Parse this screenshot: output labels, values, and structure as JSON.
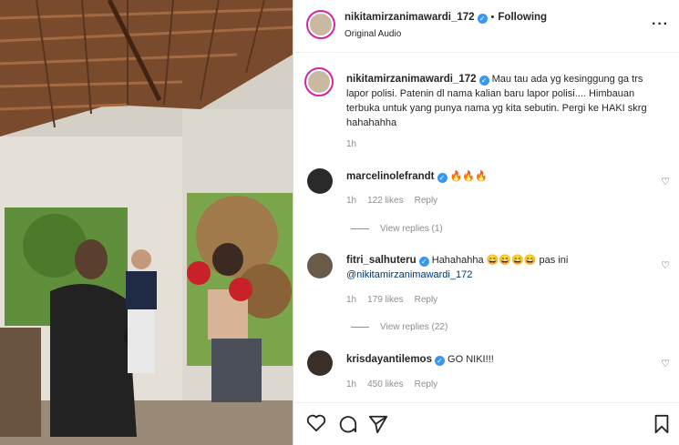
{
  "post": {
    "username": "nikitamirzanimawardi_172",
    "follow_status": "Following",
    "audio": "Original Audio",
    "caption": "Mau tau ada yg kesinggung ga trs lapor polisi. Patenin dl nama kalian baru lapor polisi.... Himbauan terbuka untuk yang punya nama yg kita sebutin. Pergi ke HAKI skrg hahahahha",
    "caption_time": "1h"
  },
  "comments": [
    {
      "username": "marcelinolefrandt",
      "text": "🔥🔥🔥",
      "time": "1h",
      "likes": "122 likes",
      "reply": "Reply",
      "view_replies": "View replies (1)"
    },
    {
      "username": "fitri_salhuteru",
      "text": "Hahahahha 😄😄😄😄 pas ini",
      "mention": "@nikitamirzanimawardi_172",
      "time": "1h",
      "likes": "179 likes",
      "reply": "Reply",
      "view_replies": "View replies (22)"
    },
    {
      "username": "krisdayantilemos",
      "text": "GO NIKI!!!",
      "time": "1h",
      "likes": "450 likes",
      "reply": "Reply"
    }
  ],
  "icons": {
    "more": "more-options-icon",
    "like": "heart-icon",
    "comment": "comment-icon",
    "share": "share-icon",
    "save": "bookmark-icon"
  },
  "colors": {
    "verified": "#3897f0",
    "story_ring": "#d6249f",
    "link": "#00376b"
  }
}
